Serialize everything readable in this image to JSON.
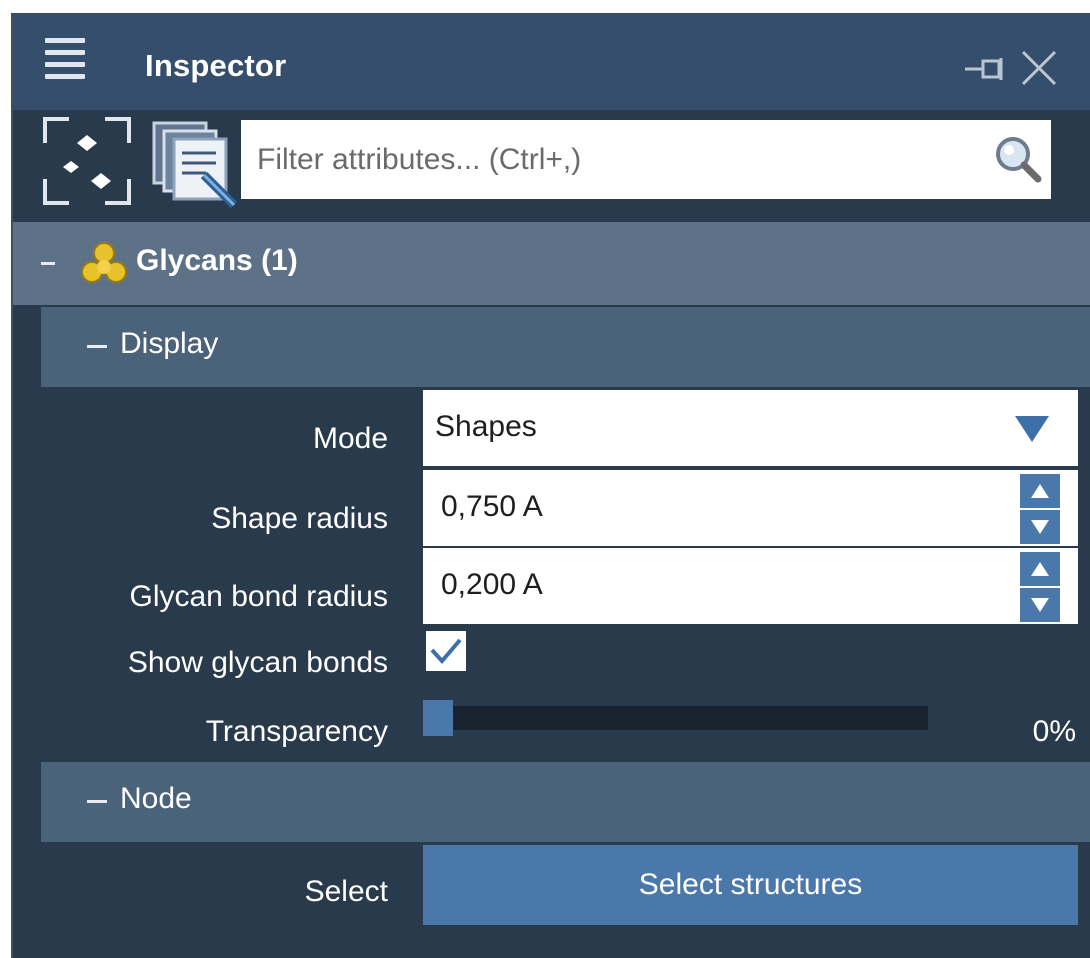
{
  "window": {
    "title": "Inspector",
    "icons": [
      "menu-icon",
      "pin-icon",
      "close-icon"
    ]
  },
  "toolbar": {
    "icons": [
      "selection-focus-icon",
      "attribute-pages-icon",
      "search-icon"
    ],
    "filter": {
      "value": "",
      "placeholder": "Filter attributes... (Ctrl+,)"
    }
  },
  "section": {
    "label": "Glycans (1)",
    "icon": "glycan-icon",
    "icon_color": "#e8c22a"
  },
  "display": {
    "label": "Display",
    "mode_label": "Mode",
    "mode_value": "Shapes",
    "shape_radius_label": "Shape radius",
    "shape_radius_value": "0,750 A",
    "bond_radius_label": "Glycan bond radius",
    "bond_radius_value": "0,200 A",
    "show_bonds_label": "Show glycan bonds",
    "show_bonds_checked": true,
    "transparency_label": "Transparency",
    "transparency_value": "0%",
    "transparency_fraction": 0
  },
  "node": {
    "label": "Node",
    "select_label": "Select",
    "select_button": "Select structures"
  },
  "colors": {
    "panel_bg": "#293a4c",
    "titlebar_bg": "#354e6b",
    "section_bg": "#5d7187",
    "subsection_bg": "#4b627b",
    "accent": "#4a78ab"
  }
}
